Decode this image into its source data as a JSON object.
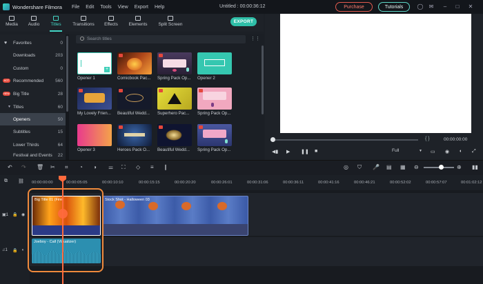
{
  "app": {
    "name": "Wondershare Filmora",
    "document_title": "Untitled : 00:00:36:12"
  },
  "menu": [
    "File",
    "Edit",
    "Tools",
    "View",
    "Export",
    "Help"
  ],
  "header": {
    "purchase": "Purchase",
    "tutorials": "Tutorials"
  },
  "media_tabs": [
    {
      "label": "Media"
    },
    {
      "label": "Audio"
    },
    {
      "label": "Titles"
    },
    {
      "label": "Transitions"
    },
    {
      "label": "Effects"
    },
    {
      "label": "Elements"
    },
    {
      "label": "Split Screen"
    }
  ],
  "export_label": "EXPORT",
  "sidebar": [
    {
      "label": "Favorites",
      "count": "0",
      "icon": "heart-icon"
    },
    {
      "label": "Downloads",
      "count": "203"
    },
    {
      "label": "Custom",
      "count": "0"
    },
    {
      "label": "Recommended",
      "count": "560",
      "tag": "HOT"
    },
    {
      "label": "Big Title",
      "count": "28",
      "tag": "NEW"
    },
    {
      "label": "Titles",
      "count": "60"
    },
    {
      "label": "Openers",
      "count": "50",
      "selected": true
    },
    {
      "label": "Subtitles",
      "count": "15"
    },
    {
      "label": "Lower Thirds",
      "count": "64"
    },
    {
      "label": "Festival and Events",
      "count": "22"
    }
  ],
  "search": {
    "placeholder": "Search titles"
  },
  "titles": [
    {
      "label": "Opener 1",
      "bg": "#ffffff",
      "accent": "#3fcfb8"
    },
    {
      "label": "Comicbook Pac...",
      "bg": "#8a3a14",
      "accent": "#ffb02e"
    },
    {
      "label": "Spring Pack Op...",
      "bg": "#3a2c47",
      "accent": "#f2a0c0"
    },
    {
      "label": "Opener 2",
      "bg": "#35c7b0",
      "accent": "#ffffff"
    },
    {
      "label": "My Lovely Frien...",
      "bg": "#2d3a6e",
      "accent": "#e8a43a"
    },
    {
      "label": "Beautiful Wedd...",
      "bg": "#151a2a",
      "accent": "#c79b58"
    },
    {
      "label": "Superhero Pac...",
      "bg": "#d8d030",
      "accent": "#111111"
    },
    {
      "label": "Spring Pack Op...",
      "bg": "#f1a8bf",
      "accent": "#7a3c86"
    },
    {
      "label": "Opener 3",
      "bg": "#e83a8c",
      "accent": "#f4a34a"
    },
    {
      "label": "Heroes Pack O...",
      "bg": "#1a2e52",
      "accent": "#e0d3a8"
    },
    {
      "label": "Beautiful Wedd...",
      "bg": "#0f1430",
      "accent": "#d4b46a"
    },
    {
      "label": "Spring Pack Op...",
      "bg": "#3d4a8a",
      "accent": "#f0a8c8"
    }
  ],
  "preview": {
    "timecode": "00:00:00:00",
    "braces": "{   }",
    "quality": "Full"
  },
  "ruler": [
    "00:00:00:00",
    "00:00:05:05",
    "00:00:10:10",
    "00:00:15:15",
    "00:00:20:20",
    "00:00:26:01",
    "00:00:31:06",
    "00:00:36:11",
    "00:00:41:16",
    "00:00:46:21",
    "00:00:52:02",
    "00:00:57:07",
    "00:01:02:12"
  ],
  "clips": {
    "video1": "Big Title 01 (Fire)",
    "video2": "Stock Shot - Halloween 03",
    "audio": "Joeboy - Call (Visualizer)"
  },
  "colors": {
    "accent": "#44d7c6",
    "playhead": "#ff6a3d",
    "highlight": "#f08a3c",
    "audio_clip": "#2c8fb0"
  }
}
